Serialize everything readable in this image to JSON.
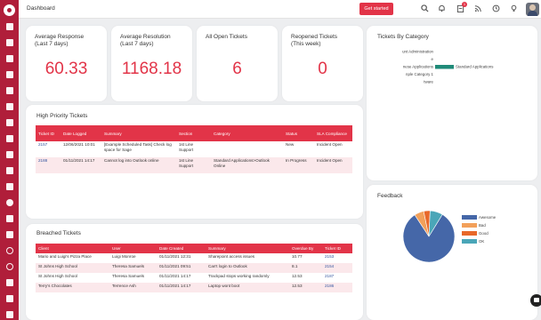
{
  "topbar": {
    "title": "Dashboard",
    "get_started": "Get started",
    "notification_count": "1"
  },
  "stats": [
    {
      "label_line1": "Average Response",
      "label_line2": "(Last 7 days)",
      "value": "60.33"
    },
    {
      "label_line1": "Average Resolution",
      "label_line2": "(Last 7 days)",
      "value": "1168.18"
    },
    {
      "label_line1": "All Open Tickets",
      "label_line2": "",
      "value": "6"
    },
    {
      "label_line1": "Reopened Tickets",
      "label_line2": "(This week)",
      "value": "0"
    }
  ],
  "high_priority": {
    "title": "High Priority Tickets",
    "columns": [
      "Ticket ID",
      "Date Logged",
      "Summary",
      "Section",
      "Category",
      "Status",
      "SLA Compliance"
    ],
    "rows": [
      {
        "id": "2157",
        "date": "12/06/2021 10:01",
        "summary": "[Example Scheduled Task] Check log space for Sage",
        "section": "1st Line Support",
        "category": "",
        "status": "New",
        "sla": "Incident Open"
      },
      {
        "id": "2188",
        "date": "01/11/2021 14:17",
        "summary": "Cannot log into Outlook online",
        "section": "1st Line Support",
        "category": "Standard Applications>Outlook Online",
        "status": "In Progress",
        "sla": "Incident Open"
      }
    ]
  },
  "breached": {
    "title": "Breached Tickets",
    "columns": [
      "Client",
      "User",
      "Date Created",
      "Summary",
      "Overdue By",
      "Ticket ID"
    ],
    "rows": [
      {
        "client": "Mario and Luigi's Pizza Place",
        "user": "Luigi Monroe",
        "date": "01/11/2021 12:31",
        "summary": "Sharepoint access issues",
        "overdue": "10.77",
        "id": "2153"
      },
      {
        "client": "St Johns High School",
        "user": "Theresa Samuels",
        "date": "01/11/2021 09:51",
        "summary": "Can't login to Outlook",
        "overdue": "8.1",
        "id": "2154"
      },
      {
        "client": "St Johns High School",
        "user": "Theresa Samuels",
        "date": "01/11/2021 14:17",
        "summary": "Trackpad stops working randomly",
        "overdue": "12.53",
        "id": "2187"
      },
      {
        "client": "Terry's Chocolates",
        "user": "Terrence Ash",
        "date": "01/11/2021 14:17",
        "summary": "Laptop wont boot",
        "overdue": "12.53",
        "id": "2186"
      }
    ]
  },
  "category_card": {
    "title": "Tickets By Category"
  },
  "feedback_card": {
    "title": "Feedback"
  },
  "chart_data": [
    {
      "type": "bar",
      "orientation": "horizontal",
      "categories": [
        "unt Administration",
        "e",
        "nese Applications",
        "nple Category 1",
        "tware"
      ],
      "series": [
        {
          "name": "Standard Applications",
          "values": [
            0,
            0,
            1,
            0,
            0
          ],
          "color": "#1f8a78"
        }
      ],
      "legend_position": "right"
    },
    {
      "type": "pie",
      "labels": [
        "Awesome",
        "Bad",
        "Good",
        "OK"
      ],
      "values": [
        82,
        6,
        4,
        8
      ],
      "colors": [
        "#4567a8",
        "#f2a05a",
        "#e8682a",
        "#4aa6b8"
      ],
      "legend_position": "right"
    }
  ],
  "colors": {
    "brand": "#b01e3a",
    "accent": "#e23448",
    "link": "#3456a0",
    "stripe": "#fbe8eb"
  }
}
